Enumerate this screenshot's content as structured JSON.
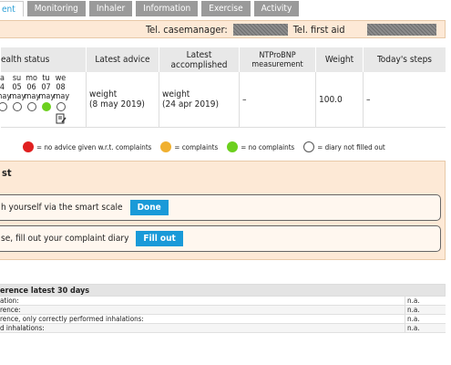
{
  "tabs": [
    "ent",
    "Monitoring",
    "Inhaler",
    "Information",
    "Exercise",
    "Activity"
  ],
  "contact": {
    "casemanager_label": "Tel. casemanager:",
    "firstaid_label": "Tel. first aid"
  },
  "status": {
    "headers": [
      "ealth status",
      "Latest advice",
      "Latest accomplished",
      "NTProBNP measurement",
      "Weight",
      "Today's steps"
    ],
    "days": [
      {
        "wd": "a",
        "num": "4",
        "mon": "may",
        "state": "open"
      },
      {
        "wd": "su",
        "num": "05",
        "mon": "may",
        "state": "open"
      },
      {
        "wd": "mo",
        "num": "06",
        "mon": "may",
        "state": "open"
      },
      {
        "wd": "tu",
        "num": "07",
        "mon": "may",
        "state": "green"
      },
      {
        "wd": "we",
        "num": "08",
        "mon": "may",
        "state": "open-note"
      }
    ],
    "latest_advice": "weight\n(8 may 2019)",
    "latest_accomplished": "weight\n(24 apr 2019)",
    "ntprobnp": "–",
    "weight": "100.0",
    "steps": "–"
  },
  "legend": [
    {
      "color": "#e02020",
      "text": "= no advice given w.r.t. complaints"
    },
    {
      "color": "#f0b030",
      "text": "= complaints"
    },
    {
      "color": "#6cd01e",
      "text": "= no complaints"
    },
    {
      "color": "#ffffff",
      "text": "= diary not filled out"
    }
  ],
  "todo": {
    "heading": "st",
    "items": [
      {
        "text": "h yourself via the smart scale",
        "button": "Done"
      },
      {
        "text": "se, fill out your complaint diary",
        "button": "Fill out"
      }
    ]
  },
  "adherence": {
    "title": "erence latest 30 days",
    "rows": [
      {
        "label": "ation:",
        "value": "n.a."
      },
      {
        "label": "rence:",
        "value": "n.a."
      },
      {
        "label": "rence, only correctly performed inhalations:",
        "value": "n.a."
      },
      {
        "label": "d inhalations:",
        "value": "n.a."
      }
    ]
  }
}
